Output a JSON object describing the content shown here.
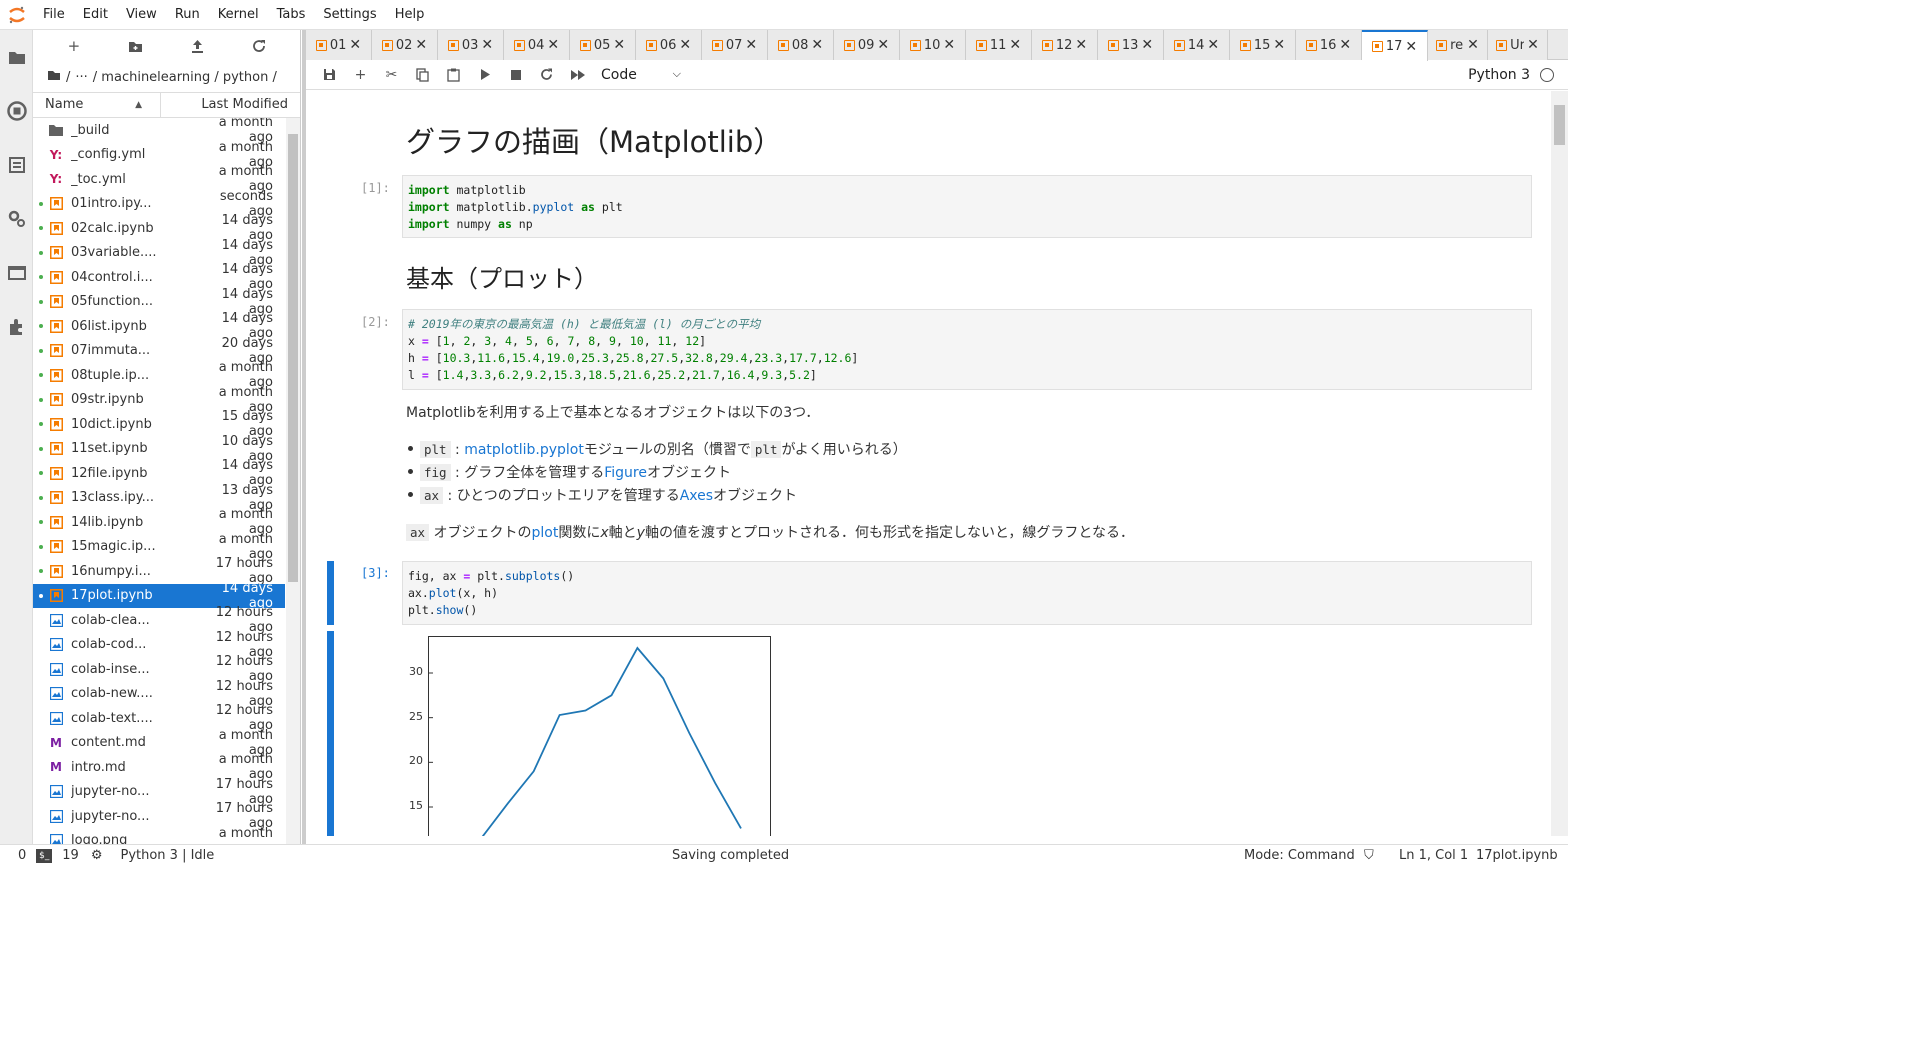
{
  "menubar": {
    "items": [
      "File",
      "Edit",
      "View",
      "Run",
      "Kernel",
      "Tabs",
      "Settings",
      "Help"
    ]
  },
  "filebrowser": {
    "breadcrumb": {
      "sep": "/",
      "ellipsis": "···",
      "path": "/ machinelearning / python /"
    },
    "header": {
      "name": "Name",
      "modified": "Last Modified"
    },
    "files": [
      {
        "name": "_build",
        "mod": "a month ago",
        "type": "folder",
        "running": false
      },
      {
        "name": "_config.yml",
        "mod": "a month ago",
        "type": "yaml",
        "running": false
      },
      {
        "name": "_toc.yml",
        "mod": "a month ago",
        "type": "yaml",
        "running": false
      },
      {
        "name": "01intro.ipy...",
        "mod": "seconds ago",
        "type": "notebook",
        "running": true
      },
      {
        "name": "02calc.ipynb",
        "mod": "14 days ago",
        "type": "notebook",
        "running": true
      },
      {
        "name": "03variable....",
        "mod": "14 days ago",
        "type": "notebook",
        "running": true
      },
      {
        "name": "04control.i...",
        "mod": "14 days ago",
        "type": "notebook",
        "running": true
      },
      {
        "name": "05function...",
        "mod": "14 days ago",
        "type": "notebook",
        "running": true
      },
      {
        "name": "06list.ipynb",
        "mod": "14 days ago",
        "type": "notebook",
        "running": true
      },
      {
        "name": "07immuta...",
        "mod": "20 days ago",
        "type": "notebook",
        "running": true
      },
      {
        "name": "08tuple.ip...",
        "mod": "a month ago",
        "type": "notebook",
        "running": true
      },
      {
        "name": "09str.ipynb",
        "mod": "a month ago",
        "type": "notebook",
        "running": true
      },
      {
        "name": "10dict.ipynb",
        "mod": "15 days ago",
        "type": "notebook",
        "running": true
      },
      {
        "name": "11set.ipynb",
        "mod": "10 days ago",
        "type": "notebook",
        "running": true
      },
      {
        "name": "12file.ipynb",
        "mod": "14 days ago",
        "type": "notebook",
        "running": true
      },
      {
        "name": "13class.ipy...",
        "mod": "13 days ago",
        "type": "notebook",
        "running": true
      },
      {
        "name": "14lib.ipynb",
        "mod": "a month ago",
        "type": "notebook",
        "running": true
      },
      {
        "name": "15magic.ip...",
        "mod": "a month ago",
        "type": "notebook",
        "running": true
      },
      {
        "name": "16numpy.i...",
        "mod": "17 hours ago",
        "type": "notebook",
        "running": true
      },
      {
        "name": "17plot.ipynb",
        "mod": "14 days ago",
        "type": "notebook",
        "running": true,
        "selected": true
      },
      {
        "name": "colab-clea...",
        "mod": "12 hours ago",
        "type": "image",
        "running": false
      },
      {
        "name": "colab-cod...",
        "mod": "12 hours ago",
        "type": "image",
        "running": false
      },
      {
        "name": "colab-inse...",
        "mod": "12 hours ago",
        "type": "image",
        "running": false
      },
      {
        "name": "colab-new....",
        "mod": "12 hours ago",
        "type": "image",
        "running": false
      },
      {
        "name": "colab-text....",
        "mod": "12 hours ago",
        "type": "image",
        "running": false
      },
      {
        "name": "content.md",
        "mod": "a month ago",
        "type": "markdown",
        "running": false
      },
      {
        "name": "intro.md",
        "mod": "a month ago",
        "type": "markdown",
        "running": false
      },
      {
        "name": "jupyter-no...",
        "mod": "17 hours ago",
        "type": "image",
        "running": false
      },
      {
        "name": "jupyter-no...",
        "mod": "17 hours ago",
        "type": "image",
        "running": false
      },
      {
        "name": "logo.png",
        "mod": "a month ago",
        "type": "image",
        "running": false
      }
    ]
  },
  "tabs": [
    "01",
    "02",
    "03",
    "04",
    "05",
    "06",
    "07",
    "08",
    "09",
    "10",
    "11",
    "12",
    "13",
    "14",
    "15",
    "16",
    "17",
    "re",
    "Ur"
  ],
  "active_tab": "17",
  "toolbar": {
    "cell_type": "Code",
    "kernel": "Python 3"
  },
  "notebook": {
    "h1": "グラフの描画（Matplotlib）",
    "h2": "基本（プロット）",
    "prompts": [
      "[1]:",
      "[2]:",
      "[3]:"
    ],
    "md1": "Matplotlibを利用する上で基本となるオブジェクトは以下の3つ．",
    "b1_code": "plt",
    "b1_sep": " : ",
    "b1_link": "matplotlib.pyplot",
    "b1_text": "モジュールの別名（慣習で",
    "b1_code2": "plt",
    "b1_text2": "がよく用いられる）",
    "b2_code": "fig",
    "b2_text": " : グラフ全体を管理する",
    "b2_link": "Figure",
    "b2_text2": "オブジェクト",
    "b3_code": "ax",
    "b3_text": " : ひとつのプロットエリアを管理する",
    "b3_link": "Axes",
    "b3_text2": "オブジェクト",
    "md2_code": "ax",
    "md2_text": "オブジェクトの",
    "md2_link": "plot",
    "md2_text2": "関数に",
    "md2_x": "x",
    "md2_text3": "軸と",
    "md2_y": "y",
    "md2_text4": "軸の値を渡すとプロットされる．何も形式を指定しないと，線グラフとなる．"
  },
  "chart_data": {
    "type": "line",
    "x": [
      1,
      2,
      3,
      4,
      5,
      6,
      7,
      8,
      9,
      10,
      11,
      12
    ],
    "values": [
      10.3,
      11.6,
      15.4,
      19.0,
      25.3,
      25.8,
      27.5,
      32.8,
      29.4,
      23.3,
      17.7,
      12.6
    ],
    "yticks": [
      "30",
      "25",
      "20",
      "15"
    ],
    "color": "#1f77b4"
  },
  "statusbar": {
    "count0": "0",
    "terminals": "19",
    "kernel": "Python 3 | Idle",
    "saving": "Saving completed",
    "mode": "Mode: Command",
    "position": "Ln 1, Col 1",
    "filename": "17plot.ipynb"
  }
}
